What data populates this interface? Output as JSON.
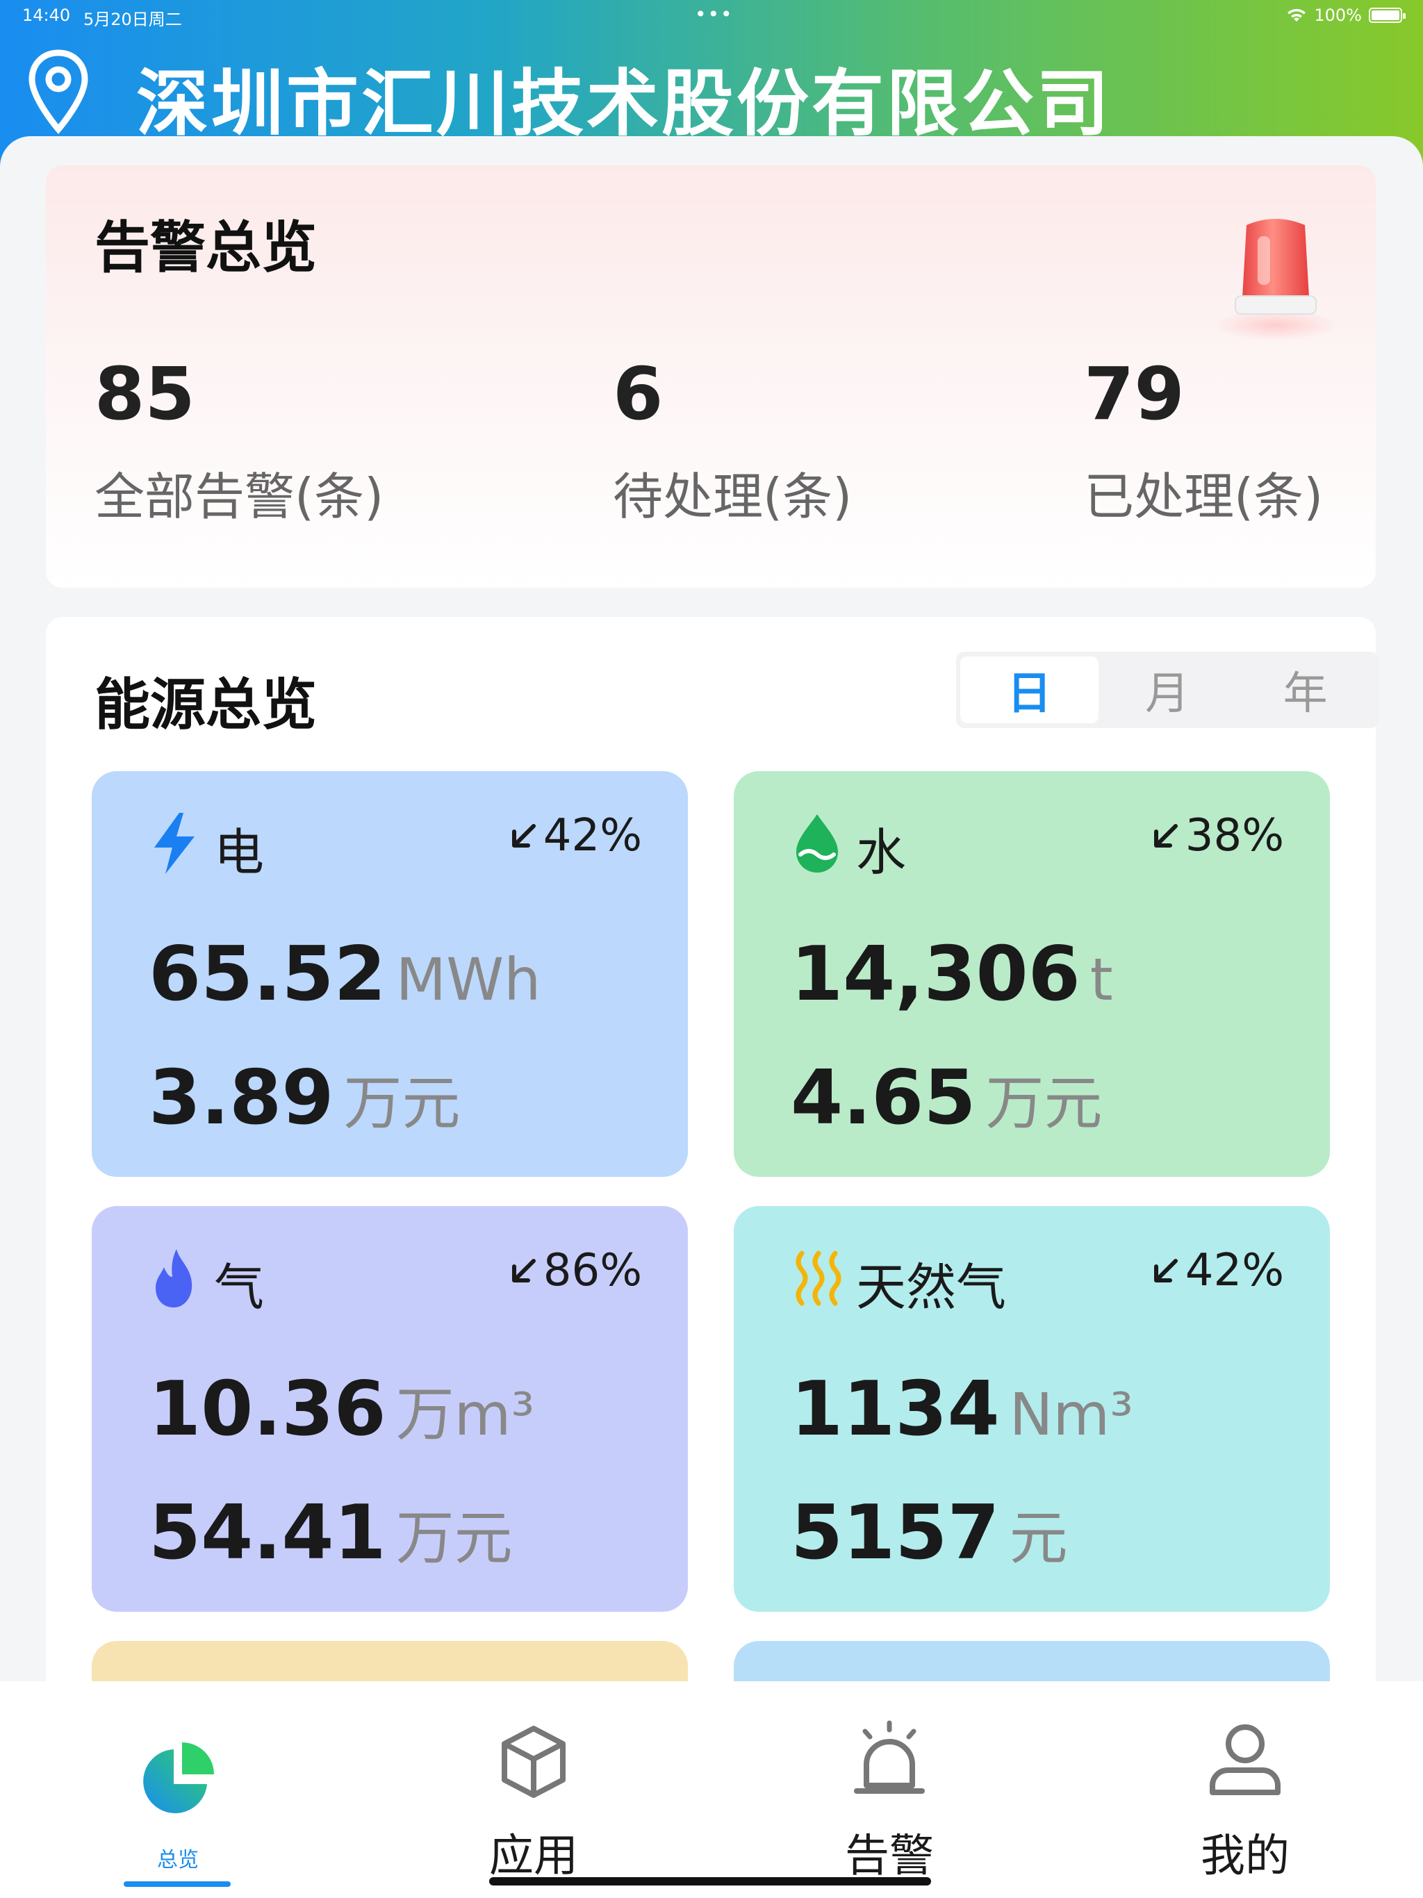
{
  "status_bar": {
    "time": "14:40",
    "date": "5月20日周二",
    "dots": "•••",
    "battery": "100%"
  },
  "header": {
    "company": "深圳市汇川技术股份有限公司"
  },
  "alarm": {
    "title": "告警总览",
    "stats": [
      {
        "value": "85",
        "label": "全部告警(条)"
      },
      {
        "value": "6",
        "label": "待处理(条)"
      },
      {
        "value": "79",
        "label": "已处理(条)"
      }
    ]
  },
  "energy": {
    "title": "能源总览",
    "periods": [
      "日",
      "月",
      "年"
    ],
    "selected_period": "日",
    "tiles": [
      {
        "name": "电",
        "icon": "lightning-icon",
        "trend": "42%",
        "amount": "65.52",
        "amount_unit": "MWh",
        "cost": "3.89",
        "cost_unit": "万元",
        "bg": "#bcd8fd"
      },
      {
        "name": "水",
        "icon": "water-drop-icon",
        "trend": "38%",
        "amount": "14,306",
        "amount_unit": "t",
        "cost": "4.65",
        "cost_unit": "万元",
        "bg": "#b9ebc9"
      },
      {
        "name": "气",
        "icon": "flame-icon",
        "trend": "86%",
        "amount": "10.36",
        "amount_unit": "万m³",
        "cost": "54.41",
        "cost_unit": "万元",
        "bg": "#c7cdfb"
      },
      {
        "name": "天然气",
        "icon": "heat-waves-icon",
        "trend": "42%",
        "amount": "1134",
        "amount_unit": "Nm³",
        "cost": "5157",
        "cost_unit": "元",
        "bg": "#b3ecec"
      }
    ]
  },
  "tabbar": {
    "tabs": [
      {
        "label": "总览",
        "icon": "pie-chart-icon",
        "active": true
      },
      {
        "label": "应用",
        "icon": "cube-icon",
        "active": false
      },
      {
        "label": "告警",
        "icon": "alarm-icon",
        "active": false
      },
      {
        "label": "我的",
        "icon": "user-icon",
        "active": false
      }
    ]
  },
  "colors": {
    "accent": "#1a8df0",
    "header_start": "#1a8df0",
    "header_end": "#88c92a",
    "alarm_red": "#f25a5a"
  }
}
